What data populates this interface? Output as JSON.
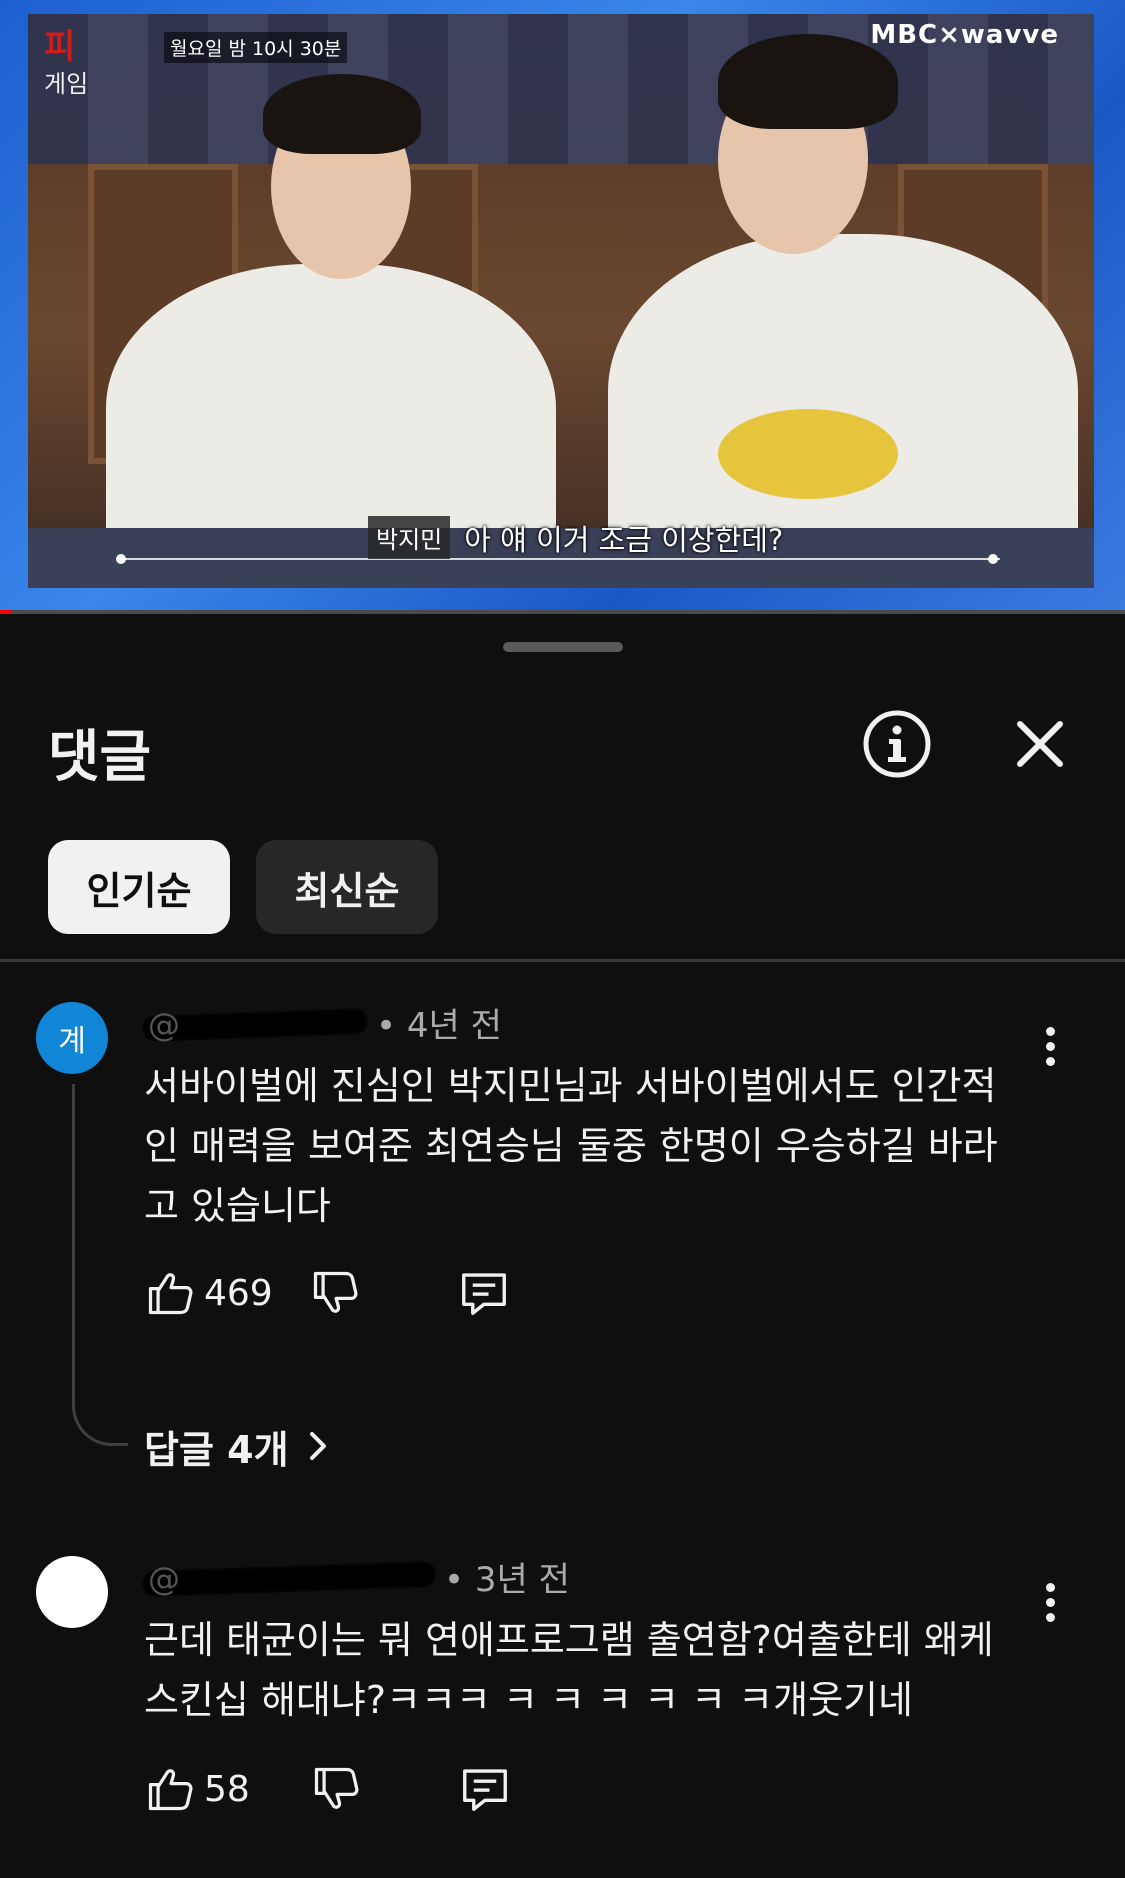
{
  "video": {
    "show_logo_main": "피",
    "show_logo_sub": "게임",
    "air_time": "월요일 밤 10시 30분",
    "broadcaster": "MBC×wavve",
    "caption_speaker": "박지민",
    "caption_text": "아 얘 이거 조금 이상한데?",
    "progress_fraction": 0.01
  },
  "sheet": {
    "title": "댓글",
    "info_icon": "info-icon",
    "close_icon": "close-icon"
  },
  "sort": {
    "top_label": "인기순",
    "newest_label": "최신순",
    "selected": "인기순"
  },
  "comments": [
    {
      "avatar_letter": "계",
      "avatar_color": "#1185d6",
      "handle": "@",
      "time": "• 4년 전",
      "text_lines": [
        "서바이벌에 진심인 박지민님과 서바이벌에서도 인간적",
        "인 매력을 보여준 최연승님 둘중 한명이 우승하길 바라",
        "고 있습니다"
      ],
      "likes": "469",
      "replies": "답글 4개"
    },
    {
      "avatar_letter": "",
      "avatar_color": "#ffffff",
      "handle": "@",
      "time": "• 3년 전",
      "text_lines": [
        "근데 태균이는 뭐 연애프로그램 출연함?여출한테 왜케",
        "스킨십 해대냐?ㅋㅋㅋ ㅋ ㅋ ㅋ ㅋ  ㅋ ㅋ개웃기네"
      ],
      "likes": "58"
    }
  ]
}
